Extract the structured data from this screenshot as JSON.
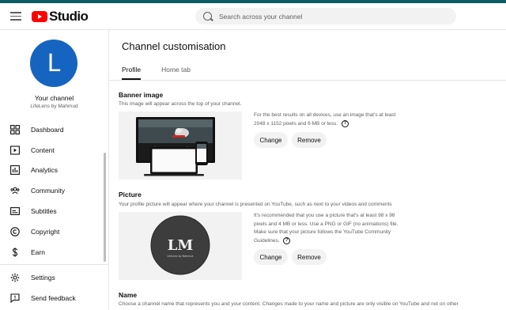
{
  "header": {
    "brand": "Studio",
    "search_placeholder": "Search across your channel"
  },
  "channel": {
    "avatar_letter": "L",
    "title": "Your channel",
    "handle": "LifeLens by Mahmud"
  },
  "nav": {
    "items": [
      {
        "label": "Dashboard",
        "icon": "dashboard-icon"
      },
      {
        "label": "Content",
        "icon": "content-icon"
      },
      {
        "label": "Analytics",
        "icon": "analytics-icon"
      },
      {
        "label": "Community",
        "icon": "community-icon"
      },
      {
        "label": "Subtitles",
        "icon": "subtitles-icon"
      },
      {
        "label": "Copyright",
        "icon": "copyright-icon"
      },
      {
        "label": "Earn",
        "icon": "earn-icon"
      }
    ],
    "bottom": [
      {
        "label": "Settings",
        "icon": "gear-icon"
      },
      {
        "label": "Send feedback",
        "icon": "feedback-icon"
      }
    ]
  },
  "page": {
    "title": "Channel customisation",
    "tabs": [
      {
        "label": "Profile",
        "active": true
      },
      {
        "label": "Home tab",
        "active": false
      }
    ]
  },
  "banner": {
    "title": "Banner image",
    "desc": "This image will appear across the top of your channel.",
    "info": "For the best results on all devices, use an image that's at least 2048 x 1152 pixels and 6 MB or less.",
    "change": "Change",
    "remove": "Remove"
  },
  "picture": {
    "title": "Picture",
    "desc": "Your profile picture will appear where your channel is presented on YouTube, such as next to your videos and comments",
    "info": "It's recommended that you use a picture that's at least 98 x 98 pixels and 4 MB or less. Use a PNG or GIF (no animations) file. Make sure that your picture follows the YouTube Community Guidelines.",
    "logo_text": "LM",
    "logo_caption": "LifeLens by Mahmud",
    "change": "Change",
    "remove": "Remove"
  },
  "name": {
    "title": "Name",
    "desc": "Choose a channel name that represents you and your content. Changes made to your name and picture are only visible on YouTube and not on other"
  },
  "colors": {
    "accent_bar": "#0b5b63",
    "brand_red": "#ff0000",
    "avatar_bg": "#1565c0"
  }
}
